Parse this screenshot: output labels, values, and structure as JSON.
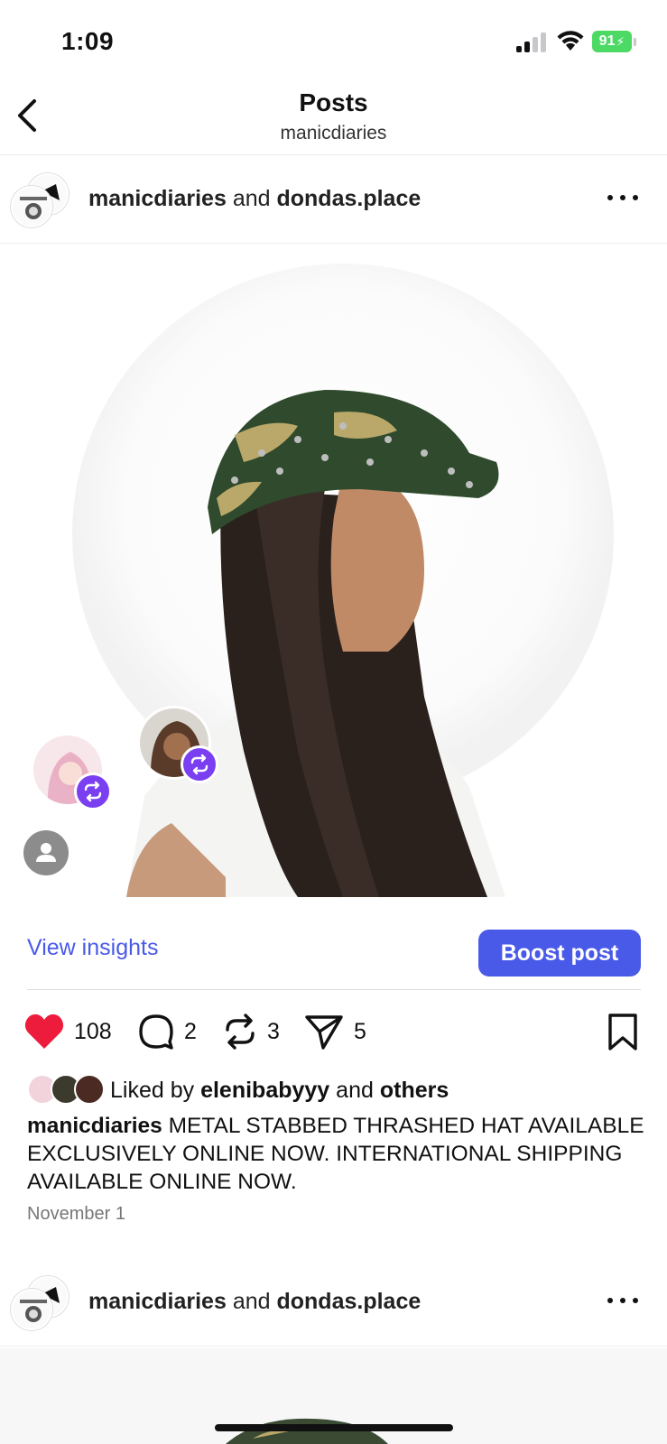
{
  "status_bar": {
    "time": "1:09",
    "battery": "91"
  },
  "header": {
    "title": "Posts",
    "subtitle": "manicdiaries"
  },
  "post": {
    "author": "manicdiaries",
    "connector": "and",
    "collaborator": "dondas.place",
    "insights_label": "View insights",
    "boost_label": "Boost post",
    "likes_count": "108",
    "comments_count": "2",
    "reposts_count": "3",
    "shares_count": "5",
    "liked_by_prefix": "Liked by",
    "liked_by_user": "elenibabyyy",
    "liked_by_connector": "and",
    "liked_by_others": "others",
    "caption_author": "manicdiaries",
    "caption_text": "METAL STABBED THRASHED HAT AVAILABLE EXCLUSIVELY ONLINE NOW. INTERNATIONAL SHIPPING AVAILABLE ONLINE NOW.",
    "date": "November 1"
  },
  "next_post": {
    "author": "manicdiaries",
    "connector": "and",
    "collaborator": "dondas.place"
  },
  "colors": {
    "accent": "#4a5ae8",
    "like": "#ed1c3c",
    "repost_badge": "#7b3ff2",
    "battery": "#4cd964"
  }
}
